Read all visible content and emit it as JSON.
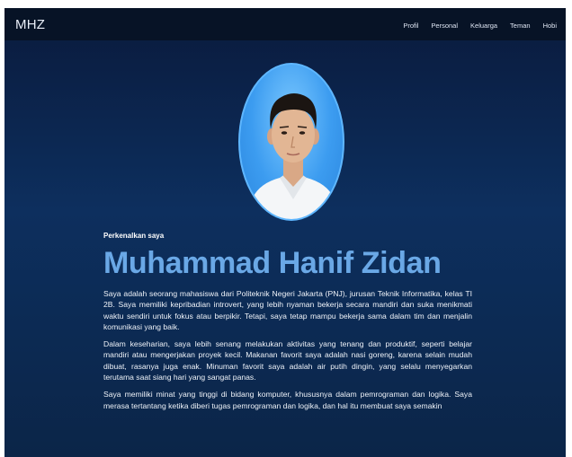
{
  "navbar": {
    "brand": "MHZ",
    "links": [
      "Profil",
      "Personal",
      "Keluarga",
      "Teman",
      "Hobi"
    ]
  },
  "hero": {
    "greeting": "Perkenalkan saya",
    "name": "Muhammad Hanif Zidan",
    "paragraphs": [
      "Saya adalah seorang mahasiswa dari Politeknik Negeri Jakarta (PNJ), jurusan Teknik Informatika, kelas TI 2B. Saya memiliki kepribadian introvert, yang lebih nyaman bekerja secara mandiri dan suka menikmati waktu sendiri untuk fokus atau berpikir. Tetapi, saya tetap mampu bekerja sama dalam tim dan menjalin komunikasi yang baik.",
      "Dalam keseharian, saya lebih senang melakukan aktivitas yang tenang dan produktif, seperti belajar mandiri atau mengerjakan proyek kecil. Makanan favorit saya adalah nasi goreng, karena selain mudah dibuat, rasanya juga enak. Minuman favorit saya adalah air putih dingin, yang selalu menyegarkan terutama saat siang hari yang sangat panas.",
      "Saya memiliki minat yang tinggi di bidang komputer, khususnya dalam pemrograman dan logika. Saya merasa tertantang ketika diberi tugas pemrograman dan logika, dan hal itu membuat saya semakin"
    ]
  },
  "colors": {
    "navbar_bg": "#071326",
    "page_bg": "#0d2f5e",
    "name_accent": "#6aa8e6",
    "avatar_border": "#5fb7ff"
  }
}
